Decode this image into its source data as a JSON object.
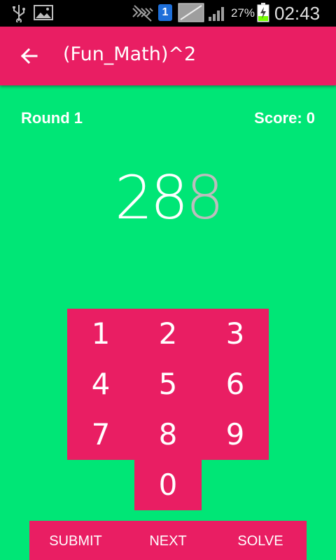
{
  "status_bar": {
    "battery_percent": "27%",
    "time": "02:43",
    "notification_count": "1",
    "icons": [
      "usb-icon",
      "gallery-icon",
      "vibrate-icon",
      "notification-badge-icon",
      "no-sim-icon",
      "signal-icon",
      "battery-charging-icon"
    ]
  },
  "app_bar": {
    "title": "(Fun_Math)^2",
    "back_icon": "arrow-back-icon"
  },
  "game": {
    "round_label": "Round 1",
    "score_label": "Score: 0",
    "number_entered": "28",
    "number_pending": "8"
  },
  "keypad": {
    "keys": [
      "1",
      "2",
      "3",
      "4",
      "5",
      "6",
      "7",
      "8",
      "9",
      "0"
    ]
  },
  "actions": {
    "submit": "SUBMIT",
    "next": "NEXT",
    "solve": "SOLVE"
  },
  "colors": {
    "background": "#00e676",
    "accent": "#e91e63",
    "text": "#ffffff",
    "pending_digit": "#bdbdbd"
  }
}
